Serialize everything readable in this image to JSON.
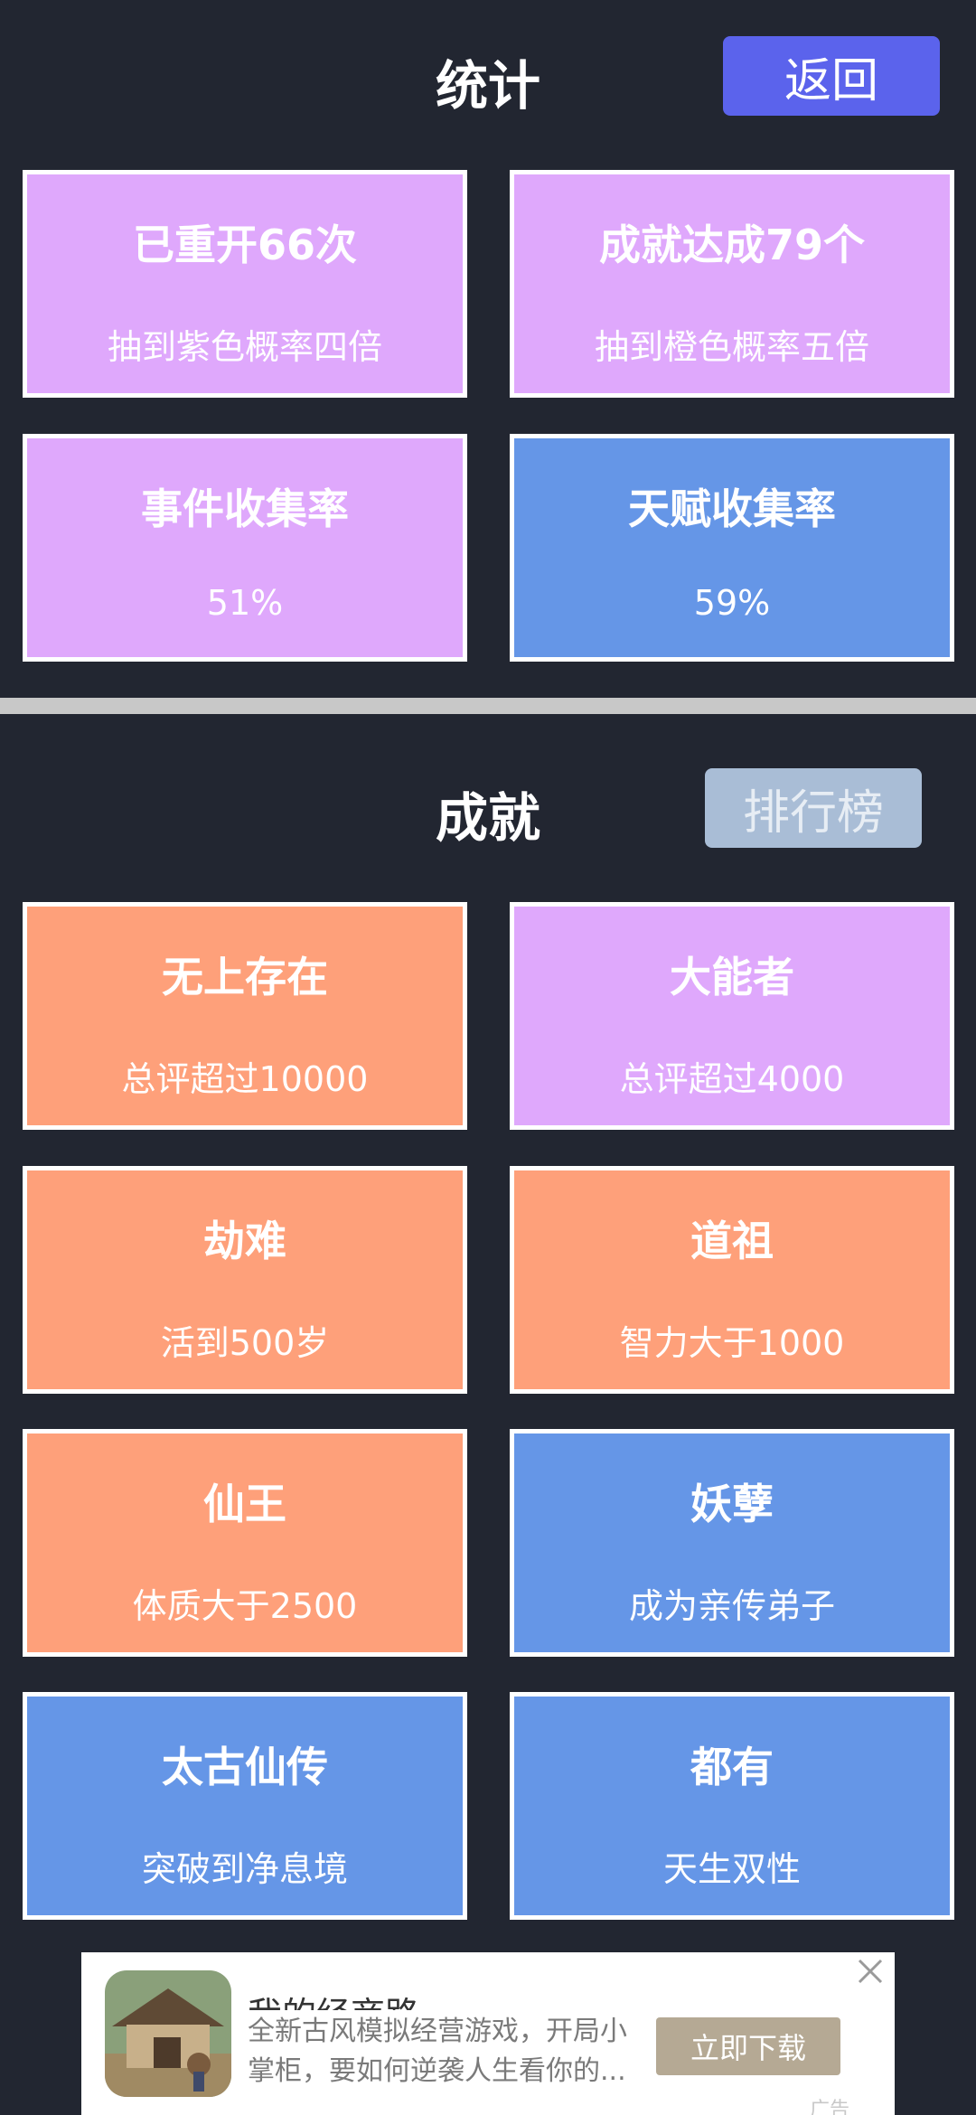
{
  "stats": {
    "title": "统计",
    "back_label": "返回",
    "cards": [
      {
        "title": "已重开66次",
        "sub": "抽到紫色概率四倍",
        "color": "#dfa8fc"
      },
      {
        "title": "成就达成79个",
        "sub": "抽到橙色概率五倍",
        "color": "#dfa8fc"
      },
      {
        "title": "事件收集率",
        "sub": "51%",
        "color": "#dfa8fc"
      },
      {
        "title": "天赋收集率",
        "sub": "59%",
        "color": "#6596e7"
      }
    ]
  },
  "achievements": {
    "title": "成就",
    "rank_label": "排行榜",
    "cards": [
      {
        "title": "无上存在",
        "sub": "总评超过10000",
        "color": "#fea07a"
      },
      {
        "title": "大能者",
        "sub": "总评超过4000",
        "color": "#dfa8fc"
      },
      {
        "title": "劫难",
        "sub": "活到500岁",
        "color": "#fea07a"
      },
      {
        "title": "道祖",
        "sub": "智力大于1000",
        "color": "#fea07a"
      },
      {
        "title": "仙王",
        "sub": "体质大于2500",
        "color": "#fea07a"
      },
      {
        "title": "妖孽",
        "sub": "成为亲传弟子",
        "color": "#6596e7"
      },
      {
        "title": "太古仙传",
        "sub": "突破到净息境",
        "color": "#6596e7"
      },
      {
        "title": "都有",
        "sub": "天生双性",
        "color": "#6596e7"
      }
    ]
  },
  "ad": {
    "title": "我的经商路",
    "description": "全新古风模拟经营游戏，开局小掌柜，要如何逆袭人生看你的...",
    "cta_label": "立即下载",
    "badge": "广告",
    "close_icon": "close-icon",
    "thumb_icon": "game-thumbnail-icon"
  },
  "colors": {
    "background": "#222631",
    "purple": "#dfa8fc",
    "blue": "#6596e7",
    "orange": "#fea07a",
    "back_button": "#5b63ec",
    "rank_button": "#a9bdd6"
  }
}
